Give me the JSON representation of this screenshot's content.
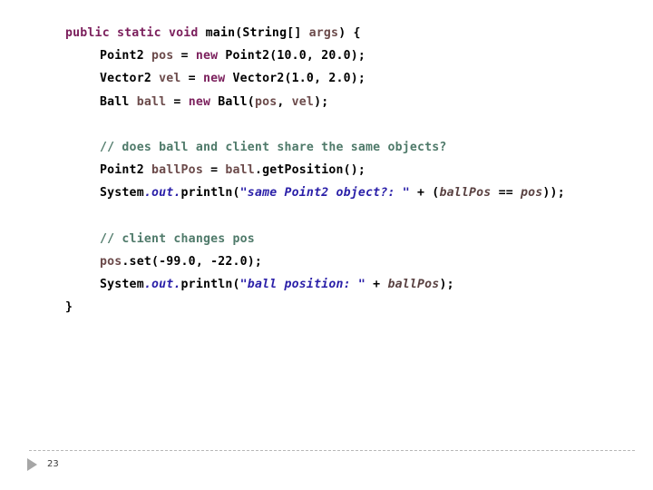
{
  "slide": {
    "background_color": "#ffffff",
    "page_number": "23",
    "bullet_icon": "triangle-right-icon"
  },
  "theme": {
    "keyword_color": "#7B1F5C",
    "comment_color": "#4F7A6A",
    "string_color": "#2A1FA8",
    "identifier_color": "#6B4A4A",
    "plain_color": "#000000",
    "rule_color": "#b8b8b8",
    "bullet_color": "#a6a6a6"
  },
  "code": {
    "language": "java",
    "lines": [
      {
        "indent": 1,
        "tokens": [
          {
            "text": "public",
            "type": "kw"
          },
          {
            "text": " ",
            "type": "plain"
          },
          {
            "text": "static",
            "type": "kw"
          },
          {
            "text": " ",
            "type": "plain"
          },
          {
            "text": "void",
            "type": "kw"
          },
          {
            "text": " main(String[] ",
            "type": "plain"
          },
          {
            "text": "args",
            "type": "ident"
          },
          {
            "text": ") {",
            "type": "plain"
          }
        ]
      },
      {
        "indent": 2,
        "tokens": [
          {
            "text": "Point2 ",
            "type": "plain"
          },
          {
            "text": "pos",
            "type": "ident"
          },
          {
            "text": " = ",
            "type": "plain"
          },
          {
            "text": "new",
            "type": "kw"
          },
          {
            "text": " Point2(10.0, 20.0);",
            "type": "plain"
          }
        ]
      },
      {
        "indent": 2,
        "tokens": [
          {
            "text": "Vector2 ",
            "type": "plain"
          },
          {
            "text": "vel",
            "type": "ident"
          },
          {
            "text": " = ",
            "type": "plain"
          },
          {
            "text": "new",
            "type": "kw"
          },
          {
            "text": " Vector2(1.0, 2.0);",
            "type": "plain"
          }
        ]
      },
      {
        "indent": 2,
        "tokens": [
          {
            "text": "Ball ",
            "type": "plain"
          },
          {
            "text": "ball",
            "type": "ident"
          },
          {
            "text": " = ",
            "type": "plain"
          },
          {
            "text": "new",
            "type": "kw"
          },
          {
            "text": " Ball(",
            "type": "plain"
          },
          {
            "text": "pos",
            "type": "ident"
          },
          {
            "text": ", ",
            "type": "plain"
          },
          {
            "text": "vel",
            "type": "ident"
          },
          {
            "text": ");",
            "type": "plain"
          }
        ]
      },
      {
        "indent": 2,
        "blank": true,
        "tokens": []
      },
      {
        "indent": 2,
        "tokens": [
          {
            "text": "// does ball and client share the same objects?",
            "type": "cmt"
          }
        ]
      },
      {
        "indent": 2,
        "tokens": [
          {
            "text": "Point2 ",
            "type": "plain"
          },
          {
            "text": "ballPos",
            "type": "ident"
          },
          {
            "text": " = ",
            "type": "plain"
          },
          {
            "text": "ball",
            "type": "ident"
          },
          {
            "text": ".getPosition();",
            "type": "plain"
          }
        ]
      },
      {
        "indent": 2,
        "tokens": [
          {
            "text": "System",
            "type": "plain"
          },
          {
            "text": ".out.",
            "type": "field"
          },
          {
            "text": "println(",
            "type": "plain"
          },
          {
            "text": "\"same Point2 object?: \"",
            "type": "str"
          },
          {
            "text": " + (",
            "type": "plain"
          },
          {
            "text": "ballPos",
            "type": "italic-id"
          },
          {
            "text": " == ",
            "type": "plain"
          },
          {
            "text": "pos",
            "type": "italic-id"
          },
          {
            "text": "));",
            "type": "plain"
          }
        ]
      },
      {
        "indent": 2,
        "blank": true,
        "tokens": []
      },
      {
        "indent": 2,
        "tokens": [
          {
            "text": "// client changes pos",
            "type": "cmt"
          }
        ]
      },
      {
        "indent": 2,
        "tokens": [
          {
            "text": "pos",
            "type": "ident"
          },
          {
            "text": ".set(-99.0, -22.0);",
            "type": "plain"
          }
        ]
      },
      {
        "indent": 2,
        "tokens": [
          {
            "text": "System",
            "type": "plain"
          },
          {
            "text": ".out.",
            "type": "field"
          },
          {
            "text": "println(",
            "type": "plain"
          },
          {
            "text": "\"ball position: \"",
            "type": "str"
          },
          {
            "text": " + ",
            "type": "plain"
          },
          {
            "text": "ballPos",
            "type": "italic-id"
          },
          {
            "text": ");",
            "type": "plain"
          }
        ]
      },
      {
        "indent": 1,
        "tokens": [
          {
            "text": "}",
            "type": "plain"
          }
        ]
      }
    ]
  }
}
